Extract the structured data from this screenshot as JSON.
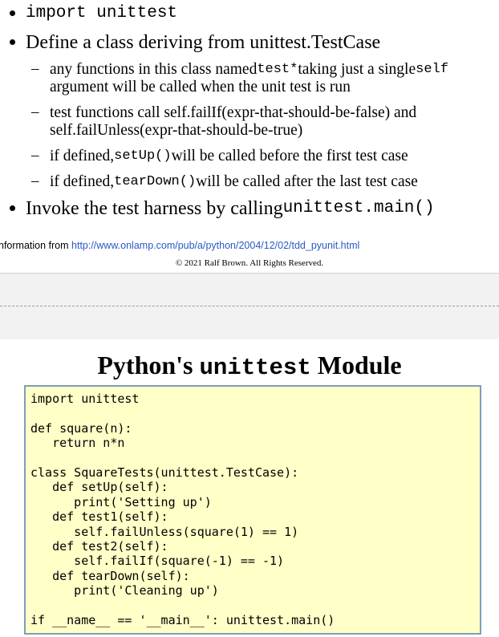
{
  "bullets": {
    "b1": {
      "code": "import unittest"
    },
    "b2": {
      "text": "Define a class deriving from unittest.TestCase"
    },
    "sub1": {
      "pre": "any functions in this class named ",
      "code1": "test*",
      "mid": " taking just a single ",
      "code2": "self",
      "line2": "argument will be called when the unit test is run"
    },
    "sub2": {
      "line1": "test functions call self.failIf(expr-that-should-be-false) and",
      "line2": "self.failUnless(expr-that-should-be-true)"
    },
    "sub3": {
      "pre": "if defined, ",
      "code": "setUp()",
      "post": " will be called before the first test case"
    },
    "sub4": {
      "pre": "if defined, ",
      "code": "tearDown()",
      "post": " will be called after the last test case"
    },
    "b3": {
      "pre": "Invoke the test harness by calling ",
      "code": "unittest.main()"
    }
  },
  "source": {
    "prefix": "nformation from ",
    "url": "http://www.onlamp.com/pub/a/python/2004/12/02/tdd_pyunit.html"
  },
  "copyright": "© 2021 Ralf Brown.  All Rights Reserved.",
  "slide2": {
    "title_pre": "Python's ",
    "title_code": "unittest",
    "title_post": " Module",
    "code": "import unittest\n\ndef square(n):\n   return n*n\n\nclass SquareTests(unittest.TestCase):\n   def setUp(self):\n      print('Setting up')\n   def test1(self):\n      self.failUnless(square(1) == 1)\n   def test2(self):\n      self.failIf(square(-1) == -1)\n   def tearDown(self):\n      print('Cleaning up')\n\nif __name__ == '__main__': unittest.main()"
  },
  "colors": {
    "link": "#2a59c6",
    "code_bg": "#ffffc8",
    "code_border": "#7f9db9",
    "band": "#f2f2f2"
  }
}
